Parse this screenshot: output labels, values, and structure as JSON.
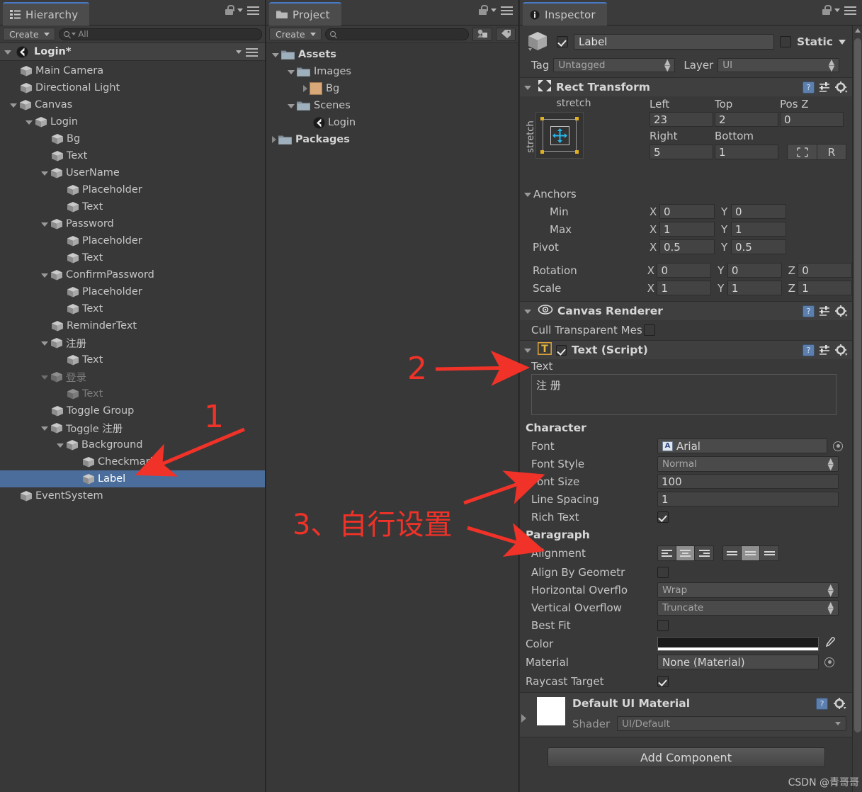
{
  "hierarchy": {
    "tab_label": "Hierarchy",
    "create_label": "Create",
    "search_placeholder": "All",
    "scene_name": "Login*",
    "items": [
      {
        "label": "Main Camera",
        "depth": 1,
        "twist": "none",
        "icon": "cube",
        "state": "normal"
      },
      {
        "label": "Directional Light",
        "depth": 1,
        "twist": "none",
        "icon": "cube",
        "state": "normal"
      },
      {
        "label": "Canvas",
        "depth": 1,
        "twist": "down",
        "icon": "cube",
        "state": "normal"
      },
      {
        "label": "Login",
        "depth": 2,
        "twist": "down",
        "icon": "cube",
        "state": "normal"
      },
      {
        "label": "Bg",
        "depth": 3,
        "twist": "none",
        "icon": "cube",
        "state": "normal"
      },
      {
        "label": "Text",
        "depth": 3,
        "twist": "none",
        "icon": "cube",
        "state": "normal"
      },
      {
        "label": "UserName",
        "depth": 3,
        "twist": "down",
        "icon": "cube",
        "state": "normal"
      },
      {
        "label": "Placeholder",
        "depth": 4,
        "twist": "none",
        "icon": "cube",
        "state": "normal"
      },
      {
        "label": "Text",
        "depth": 4,
        "twist": "none",
        "icon": "cube",
        "state": "normal"
      },
      {
        "label": "Password",
        "depth": 3,
        "twist": "down",
        "icon": "cube",
        "state": "normal"
      },
      {
        "label": "Placeholder",
        "depth": 4,
        "twist": "none",
        "icon": "cube",
        "state": "normal"
      },
      {
        "label": "Text",
        "depth": 4,
        "twist": "none",
        "icon": "cube",
        "state": "normal"
      },
      {
        "label": "ConfirmPassword",
        "depth": 3,
        "twist": "down",
        "icon": "cube",
        "state": "normal"
      },
      {
        "label": "Placeholder",
        "depth": 4,
        "twist": "none",
        "icon": "cube",
        "state": "normal"
      },
      {
        "label": "Text",
        "depth": 4,
        "twist": "none",
        "icon": "cube",
        "state": "normal"
      },
      {
        "label": "ReminderText",
        "depth": 3,
        "twist": "none",
        "icon": "cube",
        "state": "normal"
      },
      {
        "label": "注册",
        "depth": 3,
        "twist": "down",
        "icon": "cube",
        "state": "normal"
      },
      {
        "label": "Text",
        "depth": 4,
        "twist": "none",
        "icon": "cube",
        "state": "normal"
      },
      {
        "label": "登录",
        "depth": 3,
        "twist": "down",
        "icon": "cube",
        "state": "dim"
      },
      {
        "label": "Text",
        "depth": 4,
        "twist": "none",
        "icon": "cube",
        "state": "dim"
      },
      {
        "label": "Toggle Group",
        "depth": 3,
        "twist": "none",
        "icon": "cube",
        "state": "normal"
      },
      {
        "label": "Toggle 注册",
        "depth": 3,
        "twist": "down",
        "icon": "cube",
        "state": "normal"
      },
      {
        "label": "Background",
        "depth": 4,
        "twist": "down",
        "icon": "cube",
        "state": "normal"
      },
      {
        "label": "Checkmark",
        "depth": 5,
        "twist": "none",
        "icon": "cube",
        "state": "normal"
      },
      {
        "label": "Label",
        "depth": 5,
        "twist": "none",
        "icon": "cube",
        "state": "selected"
      },
      {
        "label": "EventSystem",
        "depth": 1,
        "twist": "none",
        "icon": "cube",
        "state": "normal"
      }
    ]
  },
  "project": {
    "tab_label": "Project",
    "create_label": "Create",
    "search_placeholder": "",
    "items": [
      {
        "label": "Assets",
        "depth": 0,
        "twist": "down",
        "icon": "folder",
        "bold": true
      },
      {
        "label": "Images",
        "depth": 1,
        "twist": "down",
        "icon": "folder",
        "bold": false
      },
      {
        "label": "Bg",
        "depth": 2,
        "twist": "right",
        "icon": "image",
        "bold": false
      },
      {
        "label": "Scenes",
        "depth": 1,
        "twist": "down",
        "icon": "folder",
        "bold": false
      },
      {
        "label": "Login",
        "depth": 2,
        "twist": "none",
        "icon": "unity",
        "bold": false
      },
      {
        "label": "Packages",
        "depth": 0,
        "twist": "right",
        "icon": "folder",
        "bold": true
      }
    ]
  },
  "inspector": {
    "tab_label": "Inspector",
    "object": {
      "name": "Label",
      "enabled": true,
      "static_label": "Static",
      "static_checked": false,
      "tag_label": "Tag",
      "tag_value": "Untagged",
      "layer_label": "Layer",
      "layer_value": "UI"
    },
    "rect_transform": {
      "title": "Rect Transform",
      "anchor_preset_top": "stretch",
      "anchor_preset_left": "stretch",
      "left_label": "Left",
      "left_value": "23",
      "top_label": "Top",
      "top_value": "2",
      "posz_label": "Pos Z",
      "posz_value": "0",
      "right_label": "Right",
      "right_value": "5",
      "bottom_label": "Bottom",
      "bottom_value": "1",
      "blueprint_btn": "",
      "raw_btn": "R",
      "anchors_label": "Anchors",
      "min_label": "Min",
      "min_x": "0",
      "min_y": "0",
      "max_label": "Max",
      "max_x": "1",
      "max_y": "1",
      "pivot_label": "Pivot",
      "pivot_x": "0.5",
      "pivot_y": "0.5",
      "rotation_label": "Rotation",
      "rot_x": "0",
      "rot_y": "0",
      "rot_z": "0",
      "scale_label": "Scale",
      "scale_x": "1",
      "scale_y": "1",
      "scale_z": "1",
      "axis_x": "X",
      "axis_y": "Y",
      "axis_z": "Z"
    },
    "canvas_renderer": {
      "title": "Canvas Renderer",
      "cull_label": "Cull Transparent Mes",
      "cull_checked": false
    },
    "text_script": {
      "title": "Text (Script)",
      "enabled": true,
      "text_label": "Text",
      "text_value": "注 册",
      "character_label": "Character",
      "font_label": "Font",
      "font_value": "Arial",
      "font_style_label": "Font Style",
      "font_style_value": "Normal",
      "font_size_label": "Font Size",
      "font_size_value": "100",
      "line_spacing_label": "Line Spacing",
      "line_spacing_value": "1",
      "rich_text_label": "Rich Text",
      "rich_text_checked": true,
      "paragraph_label": "Paragraph",
      "alignment_label": "Alignment",
      "alignment_h_selected": 1,
      "alignment_v_selected": 1,
      "align_geom_label": "Align By Geometr",
      "align_geom_checked": false,
      "h_overflow_label": "Horizontal Overflo",
      "h_overflow_value": "Wrap",
      "v_overflow_label": "Vertical Overflow",
      "v_overflow_value": "Truncate",
      "best_fit_label": "Best Fit",
      "best_fit_checked": false,
      "color_label": "Color",
      "color_value": "#FFFFFF",
      "material_label": "Material",
      "material_value": "None (Material)",
      "raycast_label": "Raycast Target",
      "raycast_checked": true
    },
    "material": {
      "title": "Default UI Material",
      "shader_label": "Shader",
      "shader_value": "UI/Default"
    },
    "add_component_label": "Add Component"
  },
  "annotations": {
    "one": "1",
    "two": "2",
    "three": "3、自行设置"
  },
  "watermark": "CSDN @青哥哥",
  "colors": {
    "selection_blue": "#4a6d9c",
    "annotation_red": "#f03228",
    "tab_accent": "#4779c4",
    "panel_bg": "#393939"
  }
}
